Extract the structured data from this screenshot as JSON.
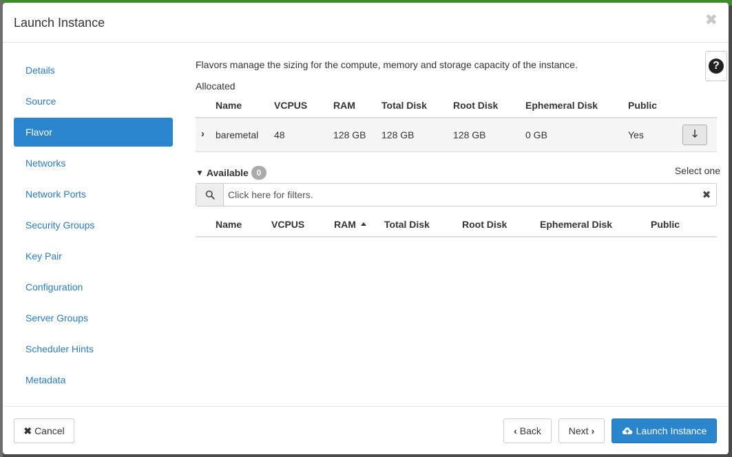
{
  "modal": {
    "title": "Launch Instance",
    "close_icon": "close-icon"
  },
  "sidebar": {
    "items": [
      {
        "label": "Details"
      },
      {
        "label": "Source"
      },
      {
        "label": "Flavor",
        "active": true
      },
      {
        "label": "Networks"
      },
      {
        "label": "Network Ports"
      },
      {
        "label": "Security Groups"
      },
      {
        "label": "Key Pair"
      },
      {
        "label": "Configuration"
      },
      {
        "label": "Server Groups"
      },
      {
        "label": "Scheduler Hints"
      },
      {
        "label": "Metadata"
      }
    ]
  },
  "flavor": {
    "description": "Flavors manage the sizing for the compute, memory and storage capacity of the instance.",
    "allocated_label": "Allocated",
    "columns": [
      "Name",
      "VCPUS",
      "RAM",
      "Total Disk",
      "Root Disk",
      "Ephemeral Disk",
      "Public"
    ],
    "allocated_rows": [
      {
        "name": "baremetal",
        "vcpus": "48",
        "ram": "128 GB",
        "total_disk": "128 GB",
        "root_disk": "128 GB",
        "ephemeral_disk": "0 GB",
        "public": "Yes"
      }
    ],
    "available_label": "Available",
    "available_count": "0",
    "select_one": "Select one",
    "filter_placeholder": "Click here for filters.",
    "available_columns": [
      "Name",
      "VCPUS",
      "RAM",
      "Total Disk",
      "Root Disk",
      "Ephemeral Disk",
      "Public"
    ],
    "sorted_column": "RAM"
  },
  "footer": {
    "cancel_label": "Cancel",
    "back_label": "Back",
    "next_label": "Next",
    "launch_label": "Launch Instance"
  },
  "colors": {
    "accent": "#2a85cc",
    "link": "#2a7ac0"
  }
}
